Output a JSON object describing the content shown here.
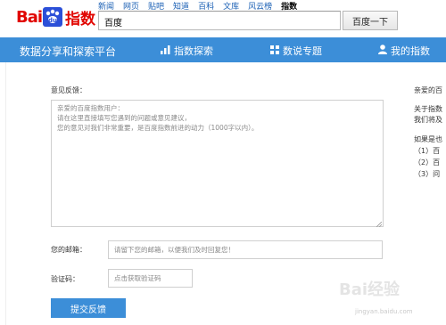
{
  "header": {
    "logo_bai": "Bai",
    "logo_du": "du",
    "logo_zhishu": "指数",
    "nav_links": [
      "新闻",
      "网页",
      "贴吧",
      "知道",
      "百科",
      "文库",
      "风云榜",
      "指数"
    ],
    "search_value": "百度",
    "search_button": "百度一下"
  },
  "bluebar": {
    "brand": "数据分享和探索平台",
    "items": [
      {
        "label": "指数探索",
        "icon": "bar-chart-icon"
      },
      {
        "label": "数说专题",
        "icon": "grid-icon"
      },
      {
        "label": "我的指数",
        "icon": "user-icon"
      }
    ]
  },
  "form": {
    "feedback_label": "意见反馈：",
    "feedback_placeholder_lines": [
      "亲爱的百度指数用户：",
      "请在这里直接填写您遇到的问题或意见建议，",
      "您的意见对我们非常重要，是百度指数前进的动力（1000字以内）。"
    ],
    "email_label": "您的邮箱：",
    "email_placeholder": "请留下您的邮箱，以便我们及时回复您！",
    "captcha_label": "验证码：",
    "captcha_placeholder": "点击获取验证码",
    "submit_label": "提交反馈"
  },
  "sidebar": {
    "line1": "亲爱的百",
    "line2": "关于指数",
    "line3": "我们将及",
    "line4": "如果是也",
    "line5": "（1）百",
    "line6": "（2）百",
    "line7": "（3）问"
  },
  "watermark": {
    "text": "Bai经验",
    "url": "jingyan.baidu.com"
  },
  "colors": {
    "brand_red": "#e10601",
    "nav_blue": "#3c8ed8",
    "link_blue": "#1a5fb4"
  }
}
